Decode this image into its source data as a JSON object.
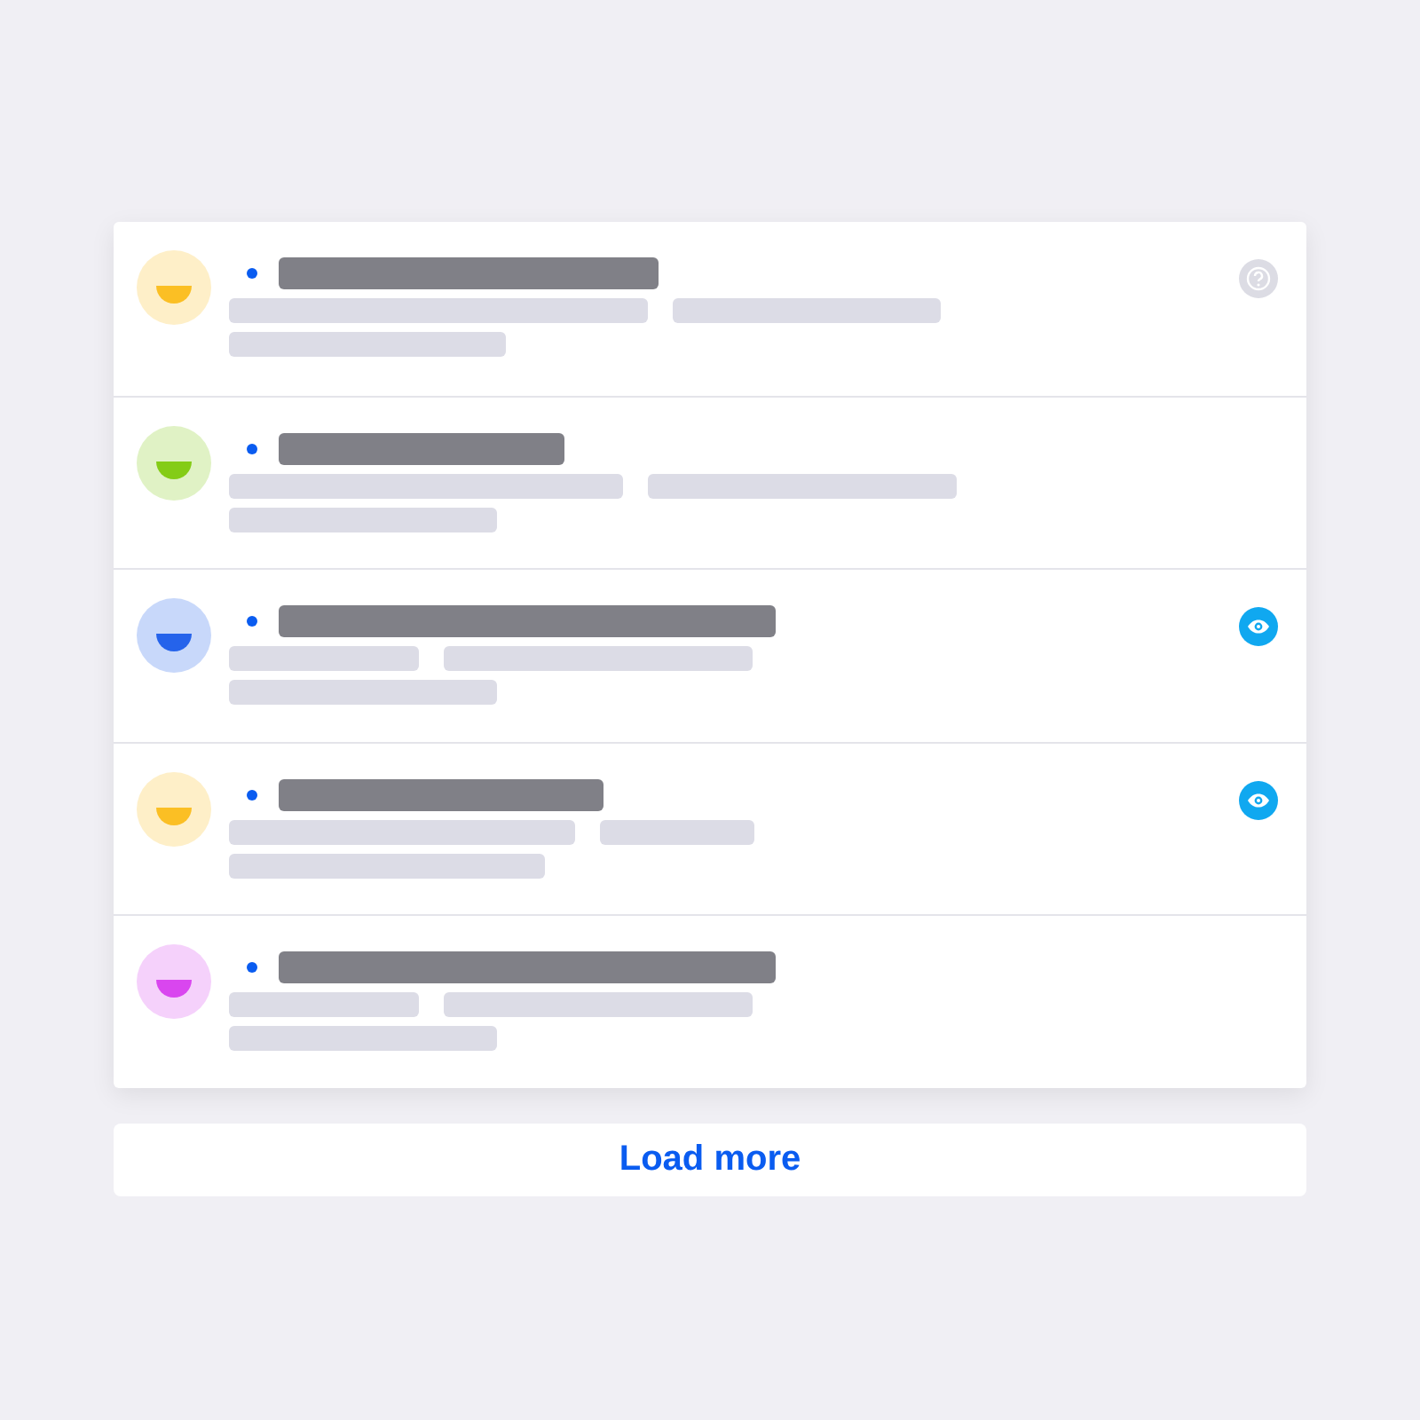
{
  "items": [
    {
      "color": "#fbbf24",
      "kind": "help"
    },
    {
      "color": "#84cc16",
      "kind": "plain"
    },
    {
      "color": "#2563eb",
      "kind": "seen"
    },
    {
      "color": "#fbbf24",
      "kind": "seen"
    },
    {
      "color": "#d946ef",
      "kind": "plain"
    }
  ],
  "load_more": "Load more"
}
